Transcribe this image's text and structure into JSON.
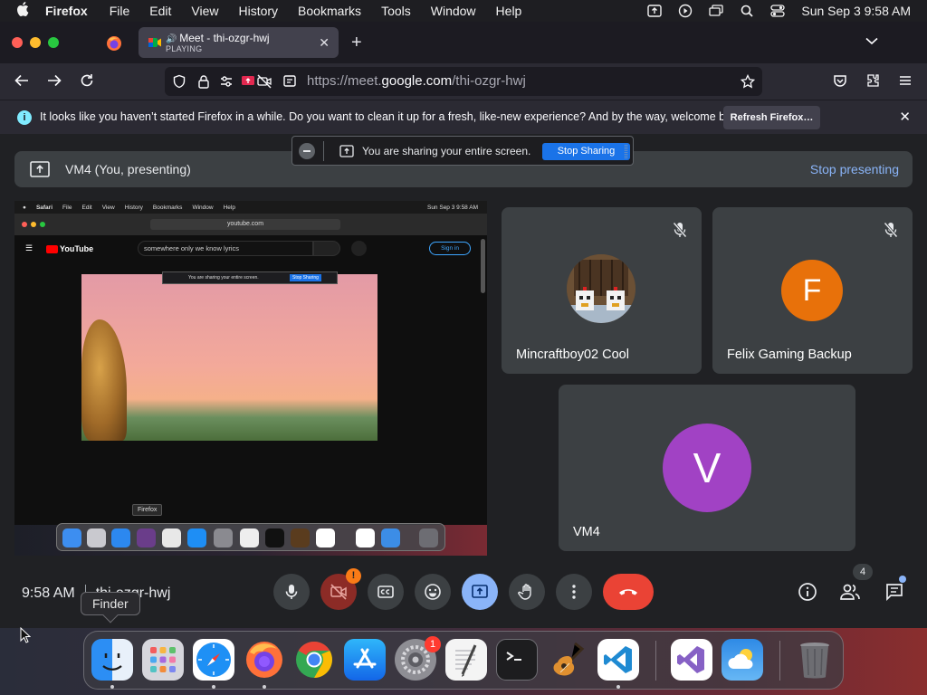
{
  "mac_menubar": {
    "app_name": "Firefox",
    "menus": [
      "File",
      "Edit",
      "View",
      "History",
      "Bookmarks",
      "Tools",
      "Window",
      "Help"
    ],
    "clock": "Sun Sep 3  9:58 AM"
  },
  "browser": {
    "tab_title": "Meet - thi-ozgr-hwj",
    "tab_status": "PLAYING",
    "url_prefix": "https://meet.",
    "url_domain": "google.com",
    "url_path": "/thi-ozgr-hwj",
    "notice_text": "It looks like you haven’t started Firefox in a while. Do you want to clean it up for a fresh, like-new experience? And by the way, welcome back!",
    "refresh_label": "Refresh Firefox…"
  },
  "share_bar": {
    "message": "You are sharing your entire screen.",
    "stop_label": "Stop Sharing"
  },
  "presenting": {
    "label": "VM4 (You, presenting)",
    "stop_label": "Stop presenting"
  },
  "preview": {
    "menubar": [
      "Safari",
      "File",
      "Edit",
      "View",
      "History",
      "Bookmarks",
      "Window",
      "Help"
    ],
    "clock": "Sun Sep 3  9:58 AM",
    "url": "youtube.com",
    "yt_logo": "YouTube",
    "search_query": "somewhere only we know lyrics",
    "signin_label": "Sign in",
    "pill_message": "You are sharing your entire screen.",
    "pill_stop": "Stop Sharing",
    "tooltip": "Firefox"
  },
  "participants": [
    {
      "name": "Mincraftboy02 Cool",
      "muted": true
    },
    {
      "name": "Felix Gaming Backup",
      "initial": "F",
      "color": "#e8710a",
      "muted": true
    },
    {
      "name": "VM4",
      "initial": "V",
      "color": "#a142c4",
      "muted": false
    }
  ],
  "meeting": {
    "time": "9:58 AM",
    "code": "thi-ozgr-hwj",
    "people_count": "4",
    "warning_badge": "!"
  },
  "dock": {
    "tooltip": "Finder",
    "settings_badge": "1"
  },
  "colors": {
    "accent_blue": "#8ab4f8",
    "hangup_red": "#ea4335",
    "stop_sharing_blue": "#1a73e8",
    "present_active": "#8ab4f8"
  }
}
